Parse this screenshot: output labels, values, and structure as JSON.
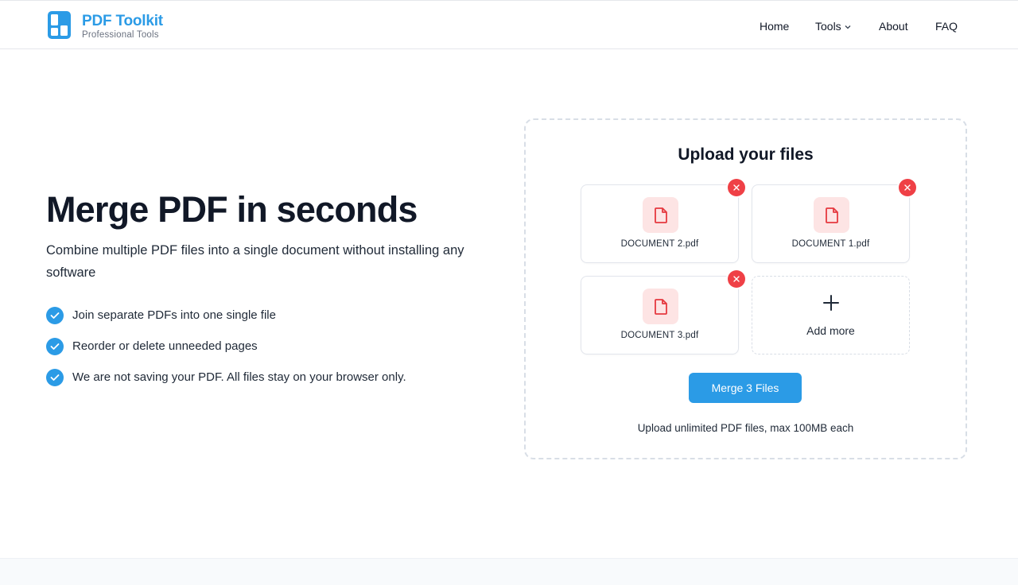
{
  "brand": {
    "title": "PDF Toolkit",
    "subtitle": "Professional Tools",
    "logo_icon": "grid-logo-icon",
    "accent_color": "#2b9be6"
  },
  "nav": {
    "home": "Home",
    "tools": "Tools",
    "about": "About",
    "faq": "FAQ"
  },
  "hero": {
    "title": "Merge PDF in seconds",
    "description": "Combine multiple PDF files into a single document without installing any software",
    "features": [
      "Join separate PDFs into one single file",
      "Reorder or delete unneeded pages",
      "We are not saving your PDF. All files stay on your browser only."
    ]
  },
  "upload": {
    "title": "Upload your files",
    "files": [
      {
        "name": "DOCUMENT 2.pdf"
      },
      {
        "name": "DOCUMENT 1.pdf"
      },
      {
        "name": "DOCUMENT 3.pdf"
      }
    ],
    "add_more_label": "Add more",
    "merge_button": "Merge 3 Files",
    "note": "Upload unlimited PDF files, max 100MB each",
    "remove_color": "#ef4046",
    "file_icon_bg": "#fde4e4"
  }
}
